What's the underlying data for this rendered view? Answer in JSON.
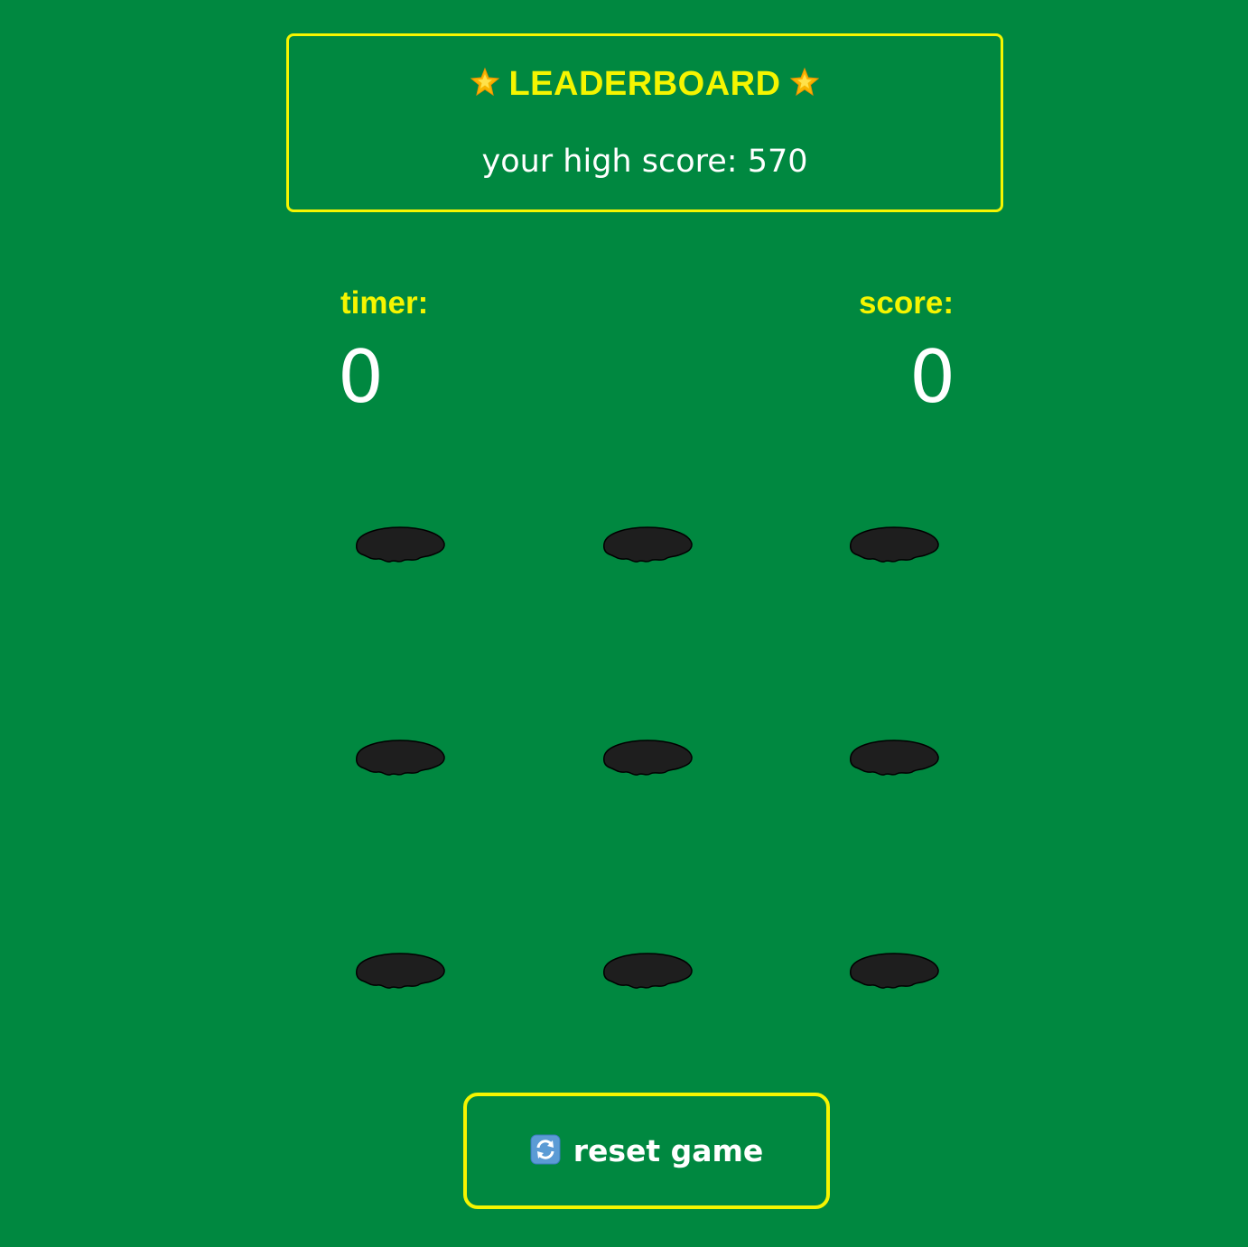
{
  "leaderboard": {
    "title": "LEADERBOARD",
    "title_icon": "glowing-star-icon",
    "high_score_text": "your high score: 570"
  },
  "stats": {
    "timer_label": "timer:",
    "timer_value": "0",
    "score_label": "score:",
    "score_value": "0"
  },
  "board": {
    "rows": 3,
    "cols": 3,
    "hole_icon": "hole-icon"
  },
  "reset": {
    "label": "reset game",
    "icon": "refresh-icon"
  },
  "colors": {
    "background": "#008840",
    "accent": "#f5f500",
    "text": "#ffffff",
    "hole": "#1e1e1e"
  }
}
